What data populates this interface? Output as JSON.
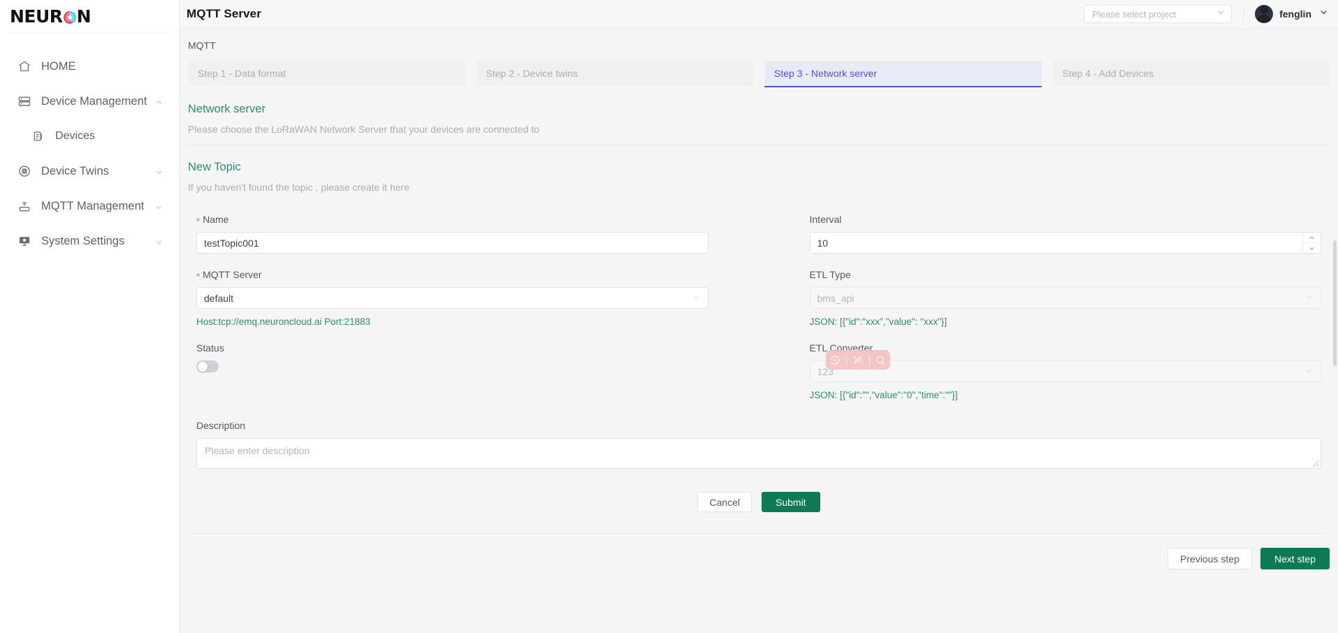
{
  "brand": {
    "logo_text_left": "NEUR",
    "logo_text_right": "N",
    "logo_mark": "neuron-circle-icon"
  },
  "sidebar": {
    "items": [
      {
        "label": "HOME",
        "icon": "home-icon",
        "expandable": false,
        "sub": false
      },
      {
        "label": "Device Management",
        "icon": "server-rack-icon",
        "expandable": true,
        "expanded": true,
        "sub": false
      },
      {
        "label": "Devices",
        "icon": "device-list-icon",
        "expandable": false,
        "sub": true
      },
      {
        "label": "Device Twins",
        "icon": "target-circle-icon",
        "expandable": true,
        "expanded": false,
        "sub": false
      },
      {
        "label": "MQTT Management",
        "icon": "router-wifi-icon",
        "expandable": true,
        "expanded": false,
        "sub": false
      },
      {
        "label": "System Settings",
        "icon": "monitor-gear-icon",
        "expandable": true,
        "expanded": false,
        "sub": false
      }
    ]
  },
  "topbar": {
    "title": "MQTT Server",
    "project_placeholder": "Please select project",
    "username": "fenglin"
  },
  "breadcrumb": {
    "label": "MQTT"
  },
  "steps": [
    {
      "label": "Step 1 - Data format",
      "active": false
    },
    {
      "label": "Step 2 - Device twins",
      "active": false
    },
    {
      "label": "Step 3 - Network server",
      "active": true
    },
    {
      "label": "Step 4 - Add Devices",
      "active": false
    }
  ],
  "network_server": {
    "heading": "Network server",
    "note": "Please choose the LoRaWAN Network Server that your devices are connected to"
  },
  "new_topic": {
    "heading": "New Topic",
    "note": "If you haven't found the topic , please create it here"
  },
  "form": {
    "name": {
      "label": "Name",
      "required": true,
      "value": "testTopic001"
    },
    "mqtt_server": {
      "label": "MQTT Server",
      "required": true,
      "value": "default"
    },
    "host_port": "Host:tcp://emq.neuroncloud.ai   Port:21883",
    "status": {
      "label": "Status",
      "on": false
    },
    "interval": {
      "label": "Interval",
      "value": "10"
    },
    "etl_type": {
      "label": "ETL Type",
      "value": "bms_api",
      "disabled": true,
      "hint": "JSON: [{\"id\":\"xxx\",\"value\":  \"xxx\"}]"
    },
    "etl_converter": {
      "label": "ETL Converter",
      "value": "123",
      "disabled": true,
      "hint": "JSON: [{\"id\":\"\",\"value\":\"0\",\"time\":\"\"}]"
    },
    "description": {
      "label": "Description",
      "placeholder": "Please enter description",
      "value": ""
    },
    "cancel_label": "Cancel",
    "submit_label": "Submit"
  },
  "wizard_nav": {
    "previous_label": "Previous step",
    "next_label": "Next step"
  },
  "ai_toolbar": {
    "icons": [
      "ai-badge-icon",
      "magic-wand-icon",
      "search-icon"
    ]
  },
  "colors": {
    "accent_green": "#0d7a55",
    "heading_teal": "#2e8b73",
    "step_active": "#4c55c4",
    "required_red": "#f5626b",
    "ai_bar_pink": "#f4c2c2"
  }
}
